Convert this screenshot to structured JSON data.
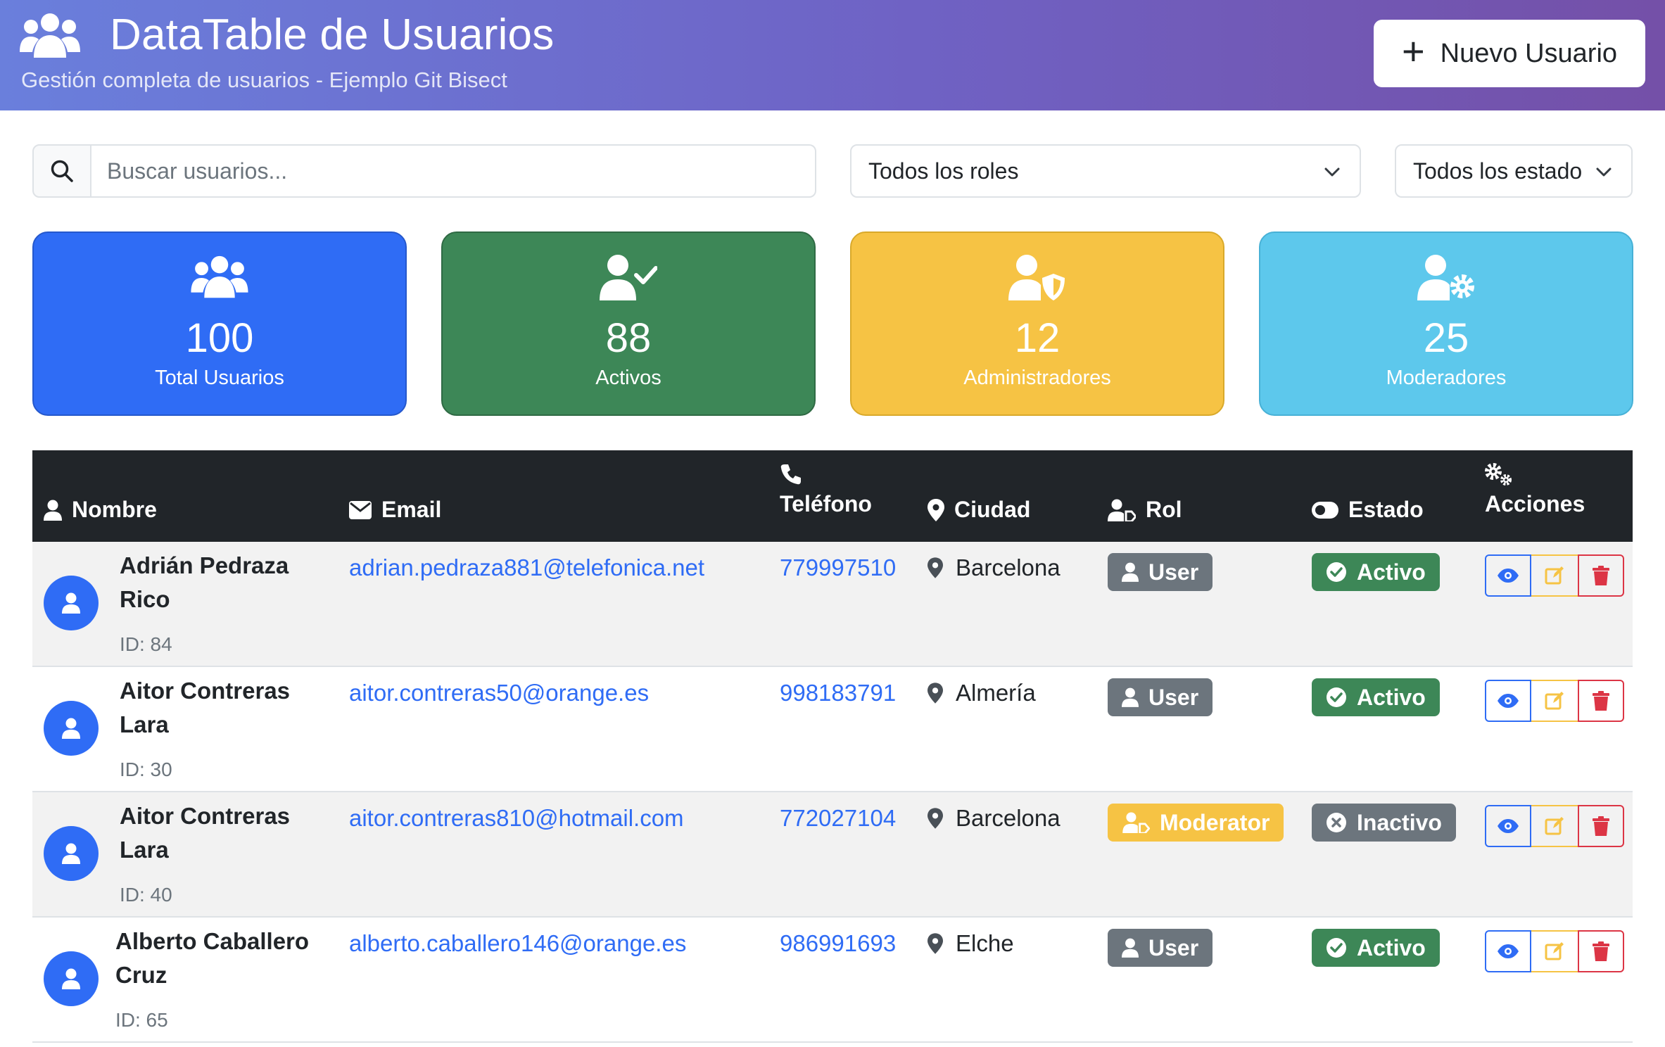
{
  "header": {
    "title": "DataTable de Usuarios",
    "subtitle": "Gestión completa de usuarios - Ejemplo Git Bisect",
    "new_user_label": "Nuevo Usuario",
    "icon": "users-icon"
  },
  "filters": {
    "search_placeholder": "Buscar usuarios...",
    "role_selected": "Todos los roles",
    "status_selected": "Todos los estados"
  },
  "stats": {
    "total": {
      "value": "100",
      "label": "Total Usuarios",
      "icon": "users-icon",
      "color": "#2f6cf5"
    },
    "active": {
      "value": "88",
      "label": "Activos",
      "icon": "user-check-icon",
      "color": "#3d8757"
    },
    "admins": {
      "value": "12",
      "label": "Administradores",
      "icon": "user-shield-icon",
      "color": "#f6c344"
    },
    "moderators": {
      "value": "25",
      "label": "Moderadores",
      "icon": "user-gear-icon",
      "color": "#5dc8ec"
    }
  },
  "table": {
    "columns": {
      "name": "Nombre",
      "email": "Email",
      "phone": "Teléfono",
      "city": "Ciudad",
      "role": "Rol",
      "status": "Estado",
      "actions": "Acciones"
    },
    "rows": [
      {
        "name_line1": "Adrián Pedraza",
        "name_line2": "Rico",
        "id": "ID: 84",
        "email": "adrian.pedraza881@telefonica.net",
        "phone": "779997510",
        "city": "Barcelona",
        "role": "User",
        "status": "Activo"
      },
      {
        "name_line1": "Aitor Contreras",
        "name_line2": "Lara",
        "id": "ID: 30",
        "email": "aitor.contreras50@orange.es",
        "phone": "998183791",
        "city": "Almería",
        "role": "User",
        "status": "Activo"
      },
      {
        "name_line1": "Aitor Contreras",
        "name_line2": "Lara",
        "id": "ID: 40",
        "email": "aitor.contreras810@hotmail.com",
        "phone": "772027104",
        "city": "Barcelona",
        "role": "Moderator",
        "status": "Inactivo"
      },
      {
        "name_line1": "Alberto Caballero",
        "name_line2": "Cruz",
        "id": "ID: 65",
        "email": "alberto.caballero146@orange.es",
        "phone": "986991693",
        "city": "Elche",
        "role": "User",
        "status": "Activo"
      }
    ]
  },
  "colors": {
    "primary": "#2f6cf5",
    "success": "#3d8757",
    "warning": "#f6c344",
    "info": "#5dc8ec",
    "secondary": "#6c757d",
    "danger": "#dc3545",
    "dark": "#212529"
  }
}
